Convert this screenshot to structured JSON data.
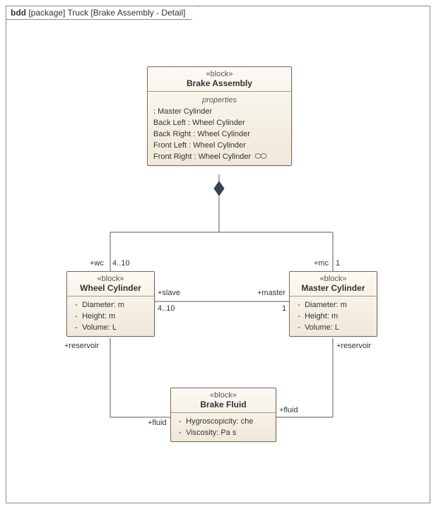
{
  "frame": {
    "kind": "bdd",
    "scope": "[package]",
    "title": "Truck [Brake Assembly - Detail]"
  },
  "blocks": {
    "brakeAssembly": {
      "stereotype": "«block»",
      "name": "Brake Assembly",
      "propertiesTitle": "properties",
      "properties": [
        " : Master Cylinder",
        "Back Left : Wheel Cylinder",
        "Back Right : Wheel Cylinder",
        "Front Left : Wheel Cylinder",
        "Front Right : Wheel Cylinder"
      ]
    },
    "wheelCylinder": {
      "stereotype": "«block»",
      "name": "Wheel Cylinder",
      "attrs": [
        {
          "vis": "-",
          "text": "Diameter: m"
        },
        {
          "vis": "-",
          "text": "Height: m"
        },
        {
          "vis": "-",
          "text": "Volume: L"
        }
      ]
    },
    "masterCylinder": {
      "stereotype": "«block»",
      "name": "Master Cylinder",
      "attrs": [
        {
          "vis": "-",
          "text": "Diameter: m"
        },
        {
          "vis": "-",
          "text": "Height: m"
        },
        {
          "vis": "-",
          "text": "Volume: L"
        }
      ]
    },
    "brakeFluid": {
      "stereotype": "«block»",
      "name": "Brake Fluid",
      "attrs": [
        {
          "vis": "-",
          "text": "Hygroscopicity: che"
        },
        {
          "vis": "-",
          "text": "Viscosity: Pa s"
        }
      ]
    }
  },
  "labels": {
    "wcRole": "+wc",
    "wcMult": "4..10",
    "mcRole": "+mc",
    "mcMult": "1",
    "slave": "+slave",
    "slaveMult": "4..10",
    "master": "+master",
    "masterMult": "1",
    "reservoirL": "+reservoir",
    "reservoirR": "+reservoir",
    "fluidL": "+fluid",
    "fluidR": "+fluid"
  }
}
